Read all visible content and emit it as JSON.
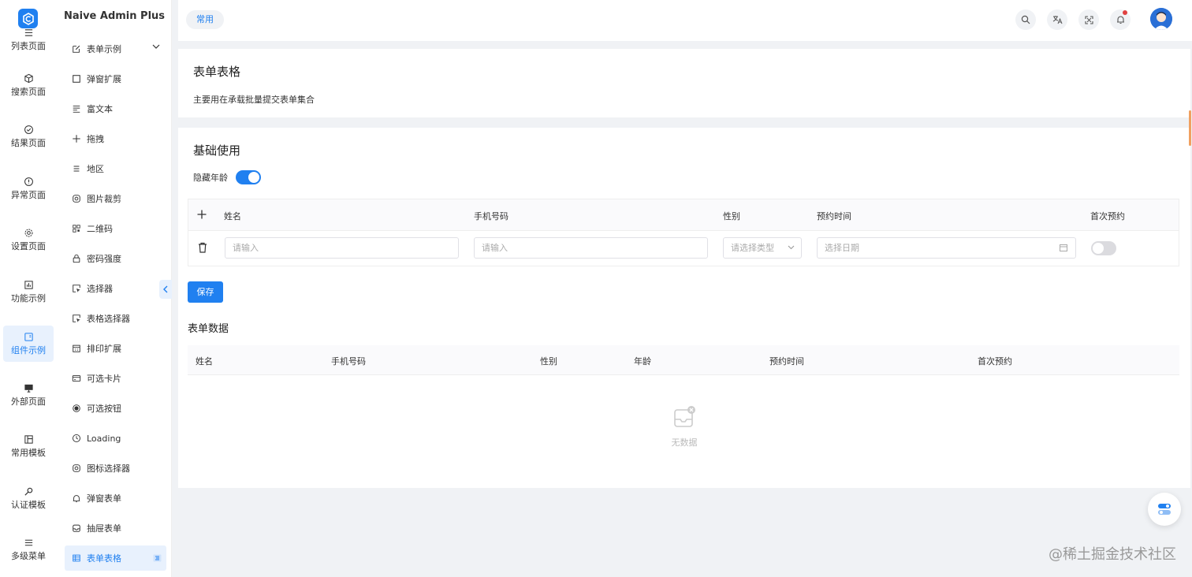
{
  "app": {
    "title": "Naive Admin Plus"
  },
  "rail": {
    "items": [
      {
        "label": "列表页面",
        "icon": "list-icon"
      },
      {
        "label": "搜索页面",
        "icon": "cube-icon"
      },
      {
        "label": "结果页面",
        "icon": "check-circle-icon"
      },
      {
        "label": "异常页面",
        "icon": "alert-circle-icon"
      },
      {
        "label": "设置页面",
        "icon": "gear-icon"
      },
      {
        "label": "功能示例",
        "icon": "chart-icon"
      },
      {
        "label": "组件示例",
        "icon": "component-icon",
        "active": true
      },
      {
        "label": "外部页面",
        "icon": "monitor-icon"
      },
      {
        "label": "常用模板",
        "icon": "template-icon"
      },
      {
        "label": "认证模板",
        "icon": "key-icon"
      },
      {
        "label": "多级菜单",
        "icon": "menu-icon"
      }
    ]
  },
  "submenu": {
    "items": [
      {
        "label": "表单示例",
        "icon": "edit-icon"
      },
      {
        "label": "弹窗扩展",
        "icon": "square-icon"
      },
      {
        "label": "富文本",
        "icon": "text-icon"
      },
      {
        "label": "拖拽",
        "icon": "move-icon"
      },
      {
        "label": "地区",
        "icon": "lines-icon"
      },
      {
        "label": "图片裁剪",
        "icon": "camera-icon"
      },
      {
        "label": "二维码",
        "icon": "qrcode-icon"
      },
      {
        "label": "密码强度",
        "icon": "lock-icon"
      },
      {
        "label": "选择器",
        "icon": "select-icon"
      },
      {
        "label": "表格选择器",
        "icon": "select-icon"
      },
      {
        "label": "排印扩展",
        "icon": "calendar-icon"
      },
      {
        "label": "可选卡片",
        "icon": "card-icon"
      },
      {
        "label": "可选按钮",
        "icon": "radio-icon"
      },
      {
        "label": "Loading",
        "icon": "clock-icon"
      },
      {
        "label": "图标选择器",
        "icon": "camera-icon"
      },
      {
        "label": "弹窗表单",
        "icon": "bell-icon"
      },
      {
        "label": "抽屉表单",
        "icon": "inbox-icon"
      },
      {
        "label": "表单表格",
        "icon": "table-icon",
        "active": true
      }
    ]
  },
  "header": {
    "tag": "常用",
    "icons": [
      "search-icon",
      "translate-icon",
      "fullscreen-icon",
      "notification-icon"
    ]
  },
  "intro": {
    "title": "表单表格",
    "description": "主要用在承载批量提交表单集合"
  },
  "basic": {
    "title": "基础使用",
    "toggle_label": "隐藏年龄",
    "toggle_on": true,
    "form_table": {
      "columns": [
        "姓名",
        "手机号码",
        "性别",
        "预约时间",
        "首次预约"
      ],
      "row": {
        "name_placeholder": "请输入",
        "phone_placeholder": "请输入",
        "gender_placeholder": "请选择类型",
        "date_placeholder": "选择日期",
        "first_visit": false
      }
    },
    "save_label": "保存",
    "data_title": "表单数据",
    "data_table": {
      "columns": [
        "姓名",
        "手机号码",
        "性别",
        "年龄",
        "预约时间",
        "首次预约"
      ],
      "empty": "无数据"
    }
  },
  "watermark": "@稀土掘金技术社区",
  "colors": {
    "primary": "#2080f0",
    "active_bg": "#e8f1fd"
  }
}
